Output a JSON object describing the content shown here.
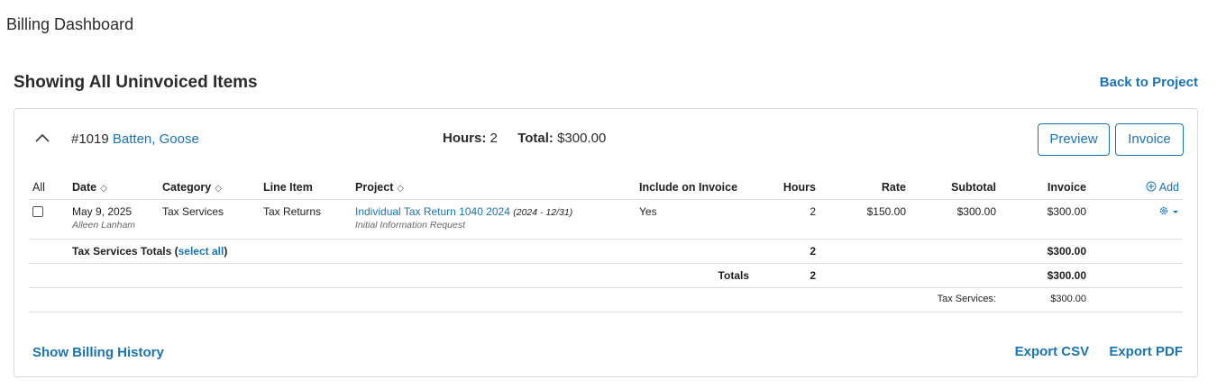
{
  "app": {
    "title": "Billing Dashboard"
  },
  "header": {
    "heading": "Showing All Uninvoiced Items",
    "back_link": "Back to Project"
  },
  "client": {
    "number": "#1019",
    "name": "Batten, Goose",
    "hours_label": "Hours:",
    "hours_value": "2",
    "total_label": "Total:",
    "total_value": "$300.00",
    "preview_button": "Preview",
    "invoice_button": "Invoice"
  },
  "table": {
    "columns": {
      "all": "All",
      "date": "Date",
      "category": "Category",
      "line_item": "Line Item",
      "project": "Project",
      "include": "Include on Invoice",
      "hours": "Hours",
      "rate": "Rate",
      "subtotal": "Subtotal",
      "invoice": "Invoice",
      "add": "Add"
    },
    "rows": [
      {
        "date": "May 9, 2025",
        "user": "Alleen Lanham",
        "category": "Tax Services",
        "line_item": "Tax Returns",
        "project": "Individual Tax Return 1040 2024",
        "project_range": "(2024 - 12/31)",
        "project_sub": "Initial Information Request",
        "include": "Yes",
        "hours": "2",
        "rate": "$150.00",
        "subtotal": "$300.00",
        "invoice": "$300.00"
      }
    ],
    "category_totals": {
      "label": "Tax Services Totals",
      "select_all": "select all",
      "hours": "2",
      "invoice": "$300.00"
    },
    "totals": {
      "label": "Totals",
      "hours": "2",
      "invoice": "$300.00"
    },
    "breakdown": {
      "label": "Tax Services:",
      "value": "$300.00"
    }
  },
  "footer": {
    "history_link": "Show Billing History",
    "export_csv": "Export CSV",
    "export_pdf": "Export PDF"
  },
  "colors": {
    "link": "#1a73b5",
    "border": "#d9d9d9"
  }
}
